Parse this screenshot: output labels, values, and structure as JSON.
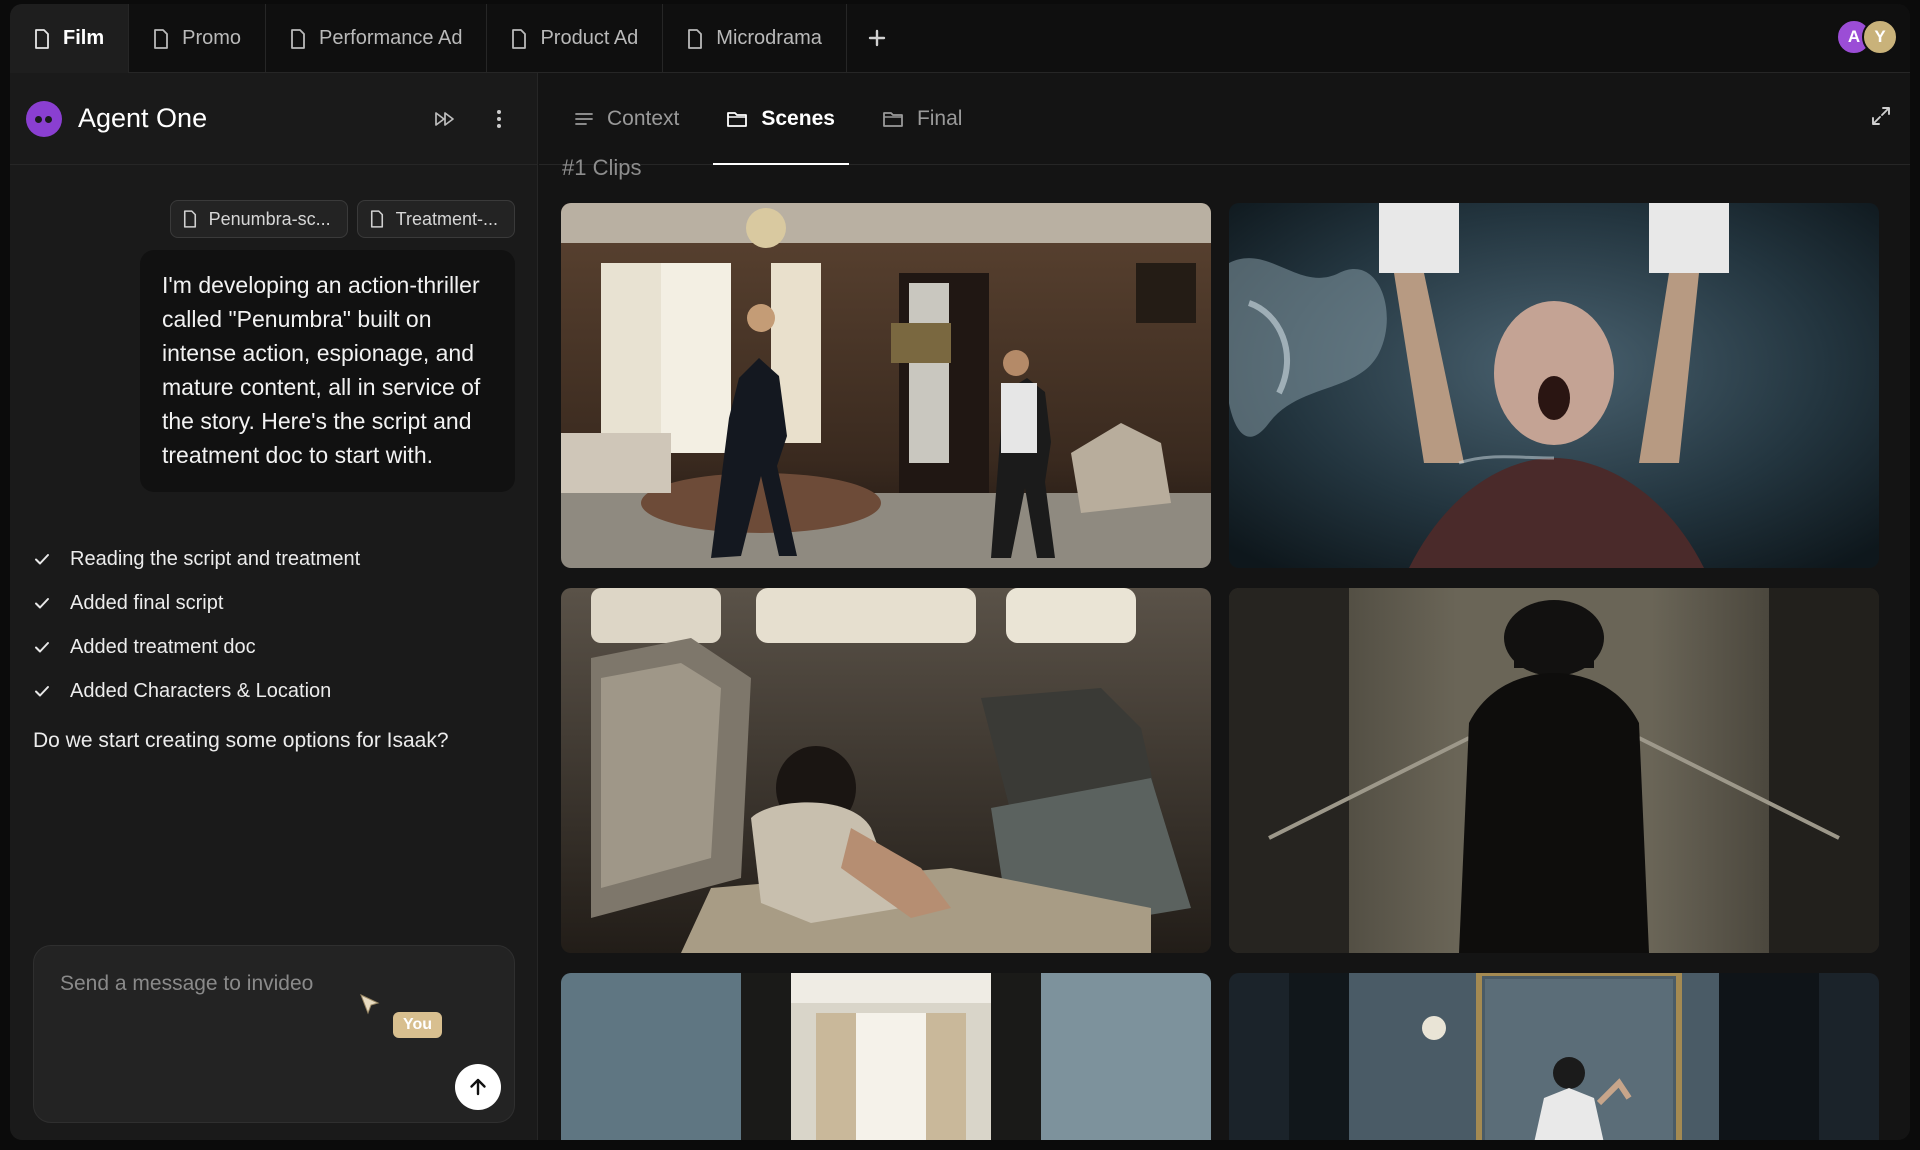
{
  "tabs": [
    {
      "label": "Film",
      "active": true
    },
    {
      "label": "Promo",
      "active": false
    },
    {
      "label": "Performance Ad",
      "active": false
    },
    {
      "label": "Product Ad",
      "active": false
    },
    {
      "label": "Microdrama",
      "active": false
    }
  ],
  "add_tab_icon": "plus-icon",
  "users": [
    {
      "initial": "A",
      "color": "#9b4dd6"
    },
    {
      "initial": "Y",
      "color": "#c9b27a"
    }
  ],
  "agent": {
    "name": "Agent One",
    "actions": [
      "fast-forward-icon",
      "more-vertical-icon"
    ]
  },
  "chat": {
    "attachments": [
      "Penumbra-sc...",
      "Treatment-..."
    ],
    "user_message": "I'm developing an action-thriller called \"Penumbra\" built on intense action, espionage, and mature content, all in service of the story. Here's the script and treatment doc to start with.",
    "steps": [
      "Reading the script and treatment",
      "Added final script",
      "Added treatment doc",
      "Added Characters & Location"
    ],
    "agent_question": "Do we start creating some options for Isaak?",
    "composer_placeholder": "Send a message to invideo",
    "cursor_label": "You"
  },
  "view_tabs": [
    {
      "label": "Context",
      "icon": "lines-icon",
      "active": false
    },
    {
      "label": "Scenes",
      "icon": "folder-icon",
      "active": true
    },
    {
      "label": "Final",
      "icon": "folder-icon",
      "active": false
    }
  ],
  "section_title": "#1 Clips",
  "clips": [
    {
      "scene": "ornate hotel room fight",
      "palette": [
        "#4a3526",
        "#8a6a4a",
        "#2a1f18"
      ]
    },
    {
      "scene": "man held underwater",
      "palette": [
        "#1c2a33",
        "#3c5260",
        "#0d1419"
      ]
    },
    {
      "scene": "girl huddled in bus",
      "palette": [
        "#3b352c",
        "#6e665a",
        "#1f1c18"
      ]
    },
    {
      "scene": "silhouette in dark corridor",
      "palette": [
        "#2f2c25",
        "#5a564c",
        "#151411"
      ]
    },
    {
      "scene": "bright window doorway",
      "palette": [
        "#2f3c44",
        "#c9c2b3",
        "#1a2125"
      ]
    },
    {
      "scene": "man in mirror room",
      "palette": [
        "#1f2830",
        "#4a5860",
        "#101519"
      ]
    }
  ]
}
